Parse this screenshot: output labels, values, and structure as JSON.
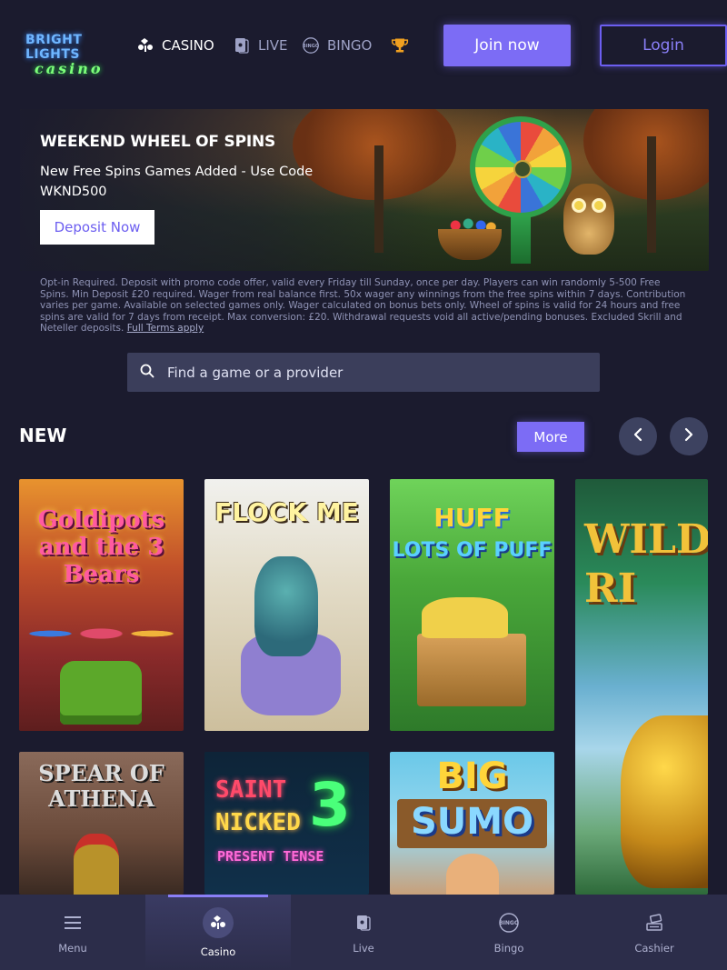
{
  "header": {
    "logo_line1": "BRIGHT LIGHTS",
    "logo_line2": "casino",
    "nav": [
      {
        "label": "CASINO",
        "icon": "cards-icon"
      },
      {
        "label": "LIVE",
        "icon": "live-cards-icon"
      },
      {
        "label": "BINGO",
        "icon": "bingo-icon"
      },
      {
        "label": "",
        "icon": "trophy-icon"
      }
    ],
    "join_label": "Join now",
    "login_label": "Login"
  },
  "promo": {
    "title": "WEEKEND WHEEL OF SPINS",
    "subtitle": "New Free Spins Games Added - Use Code WKND500",
    "cta_label": "Deposit Now",
    "terms": "Opt-in Required. Deposit with promo code offer, valid every Friday till Sunday, once per day. Players can win randomly 5-500 Free Spins. Min Deposit £20 required. Wager from real balance first. 50x wager any winnings from the free spins within 7 days. Contribution varies per game. Available on selected games only. Wager calculated on bonus bets only. Wheel of spins is valid for 24 hours and free spins are valid for 7 days from receipt. Max conversion: £20. Withdrawal requests void all active/pending bonuses. Excluded Skrill and Neteller deposits.",
    "terms_link": "Full Terms apply"
  },
  "search": {
    "placeholder": "Find a game or a provider"
  },
  "section": {
    "title": "NEW",
    "more_label": "More"
  },
  "games": [
    {
      "title": "Goldipots and the 3 Bears"
    },
    {
      "title": "FLOCK ME"
    },
    {
      "title": "HUFF",
      "title2": "LOTS OF PUFF"
    },
    {
      "title": "WILD RI"
    },
    {
      "title": "SPEAR OF ATHENA"
    },
    {
      "title_line1": "SAINT",
      "title_line2": "NICKED",
      "title_num": "3",
      "title_sub": "PRESENT TENSE"
    },
    {
      "title": "BIG",
      "title2": "SUMO"
    }
  ],
  "bottom_nav": [
    {
      "label": "Menu",
      "icon": "hamburger-icon"
    },
    {
      "label": "Casino",
      "icon": "cards-icon",
      "active": true
    },
    {
      "label": "Live",
      "icon": "live-cards-icon"
    },
    {
      "label": "Bingo",
      "icon": "bingo-icon"
    },
    {
      "label": "Cashier",
      "icon": "cashier-icon"
    }
  ],
  "colors": {
    "background": "#1b1b2e",
    "accent": "#7c6cf5",
    "nav_bar": "#2c2d4a"
  }
}
